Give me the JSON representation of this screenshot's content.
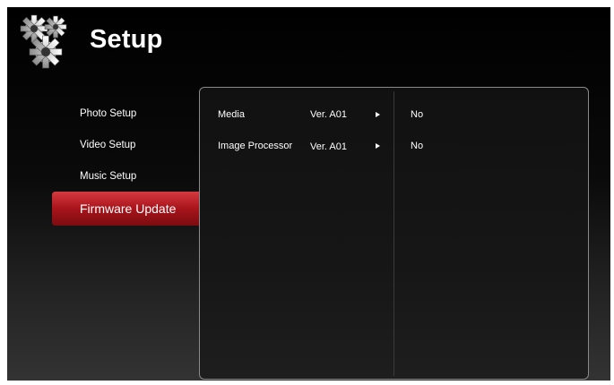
{
  "header": {
    "title": "Setup",
    "icon": "gears-icon"
  },
  "menu": {
    "items": [
      {
        "label": "Photo Setup"
      },
      {
        "label": "Video Setup"
      },
      {
        "label": "Music Setup"
      },
      {
        "label": "Firmware Update",
        "active": true
      }
    ],
    "active_color": "#b0141a"
  },
  "firmware": {
    "rows": [
      {
        "name": "Media",
        "version": "Ver. A01",
        "update": "No"
      },
      {
        "name": "Image Processor",
        "version": "Ver. A01",
        "update": "No"
      }
    ]
  }
}
